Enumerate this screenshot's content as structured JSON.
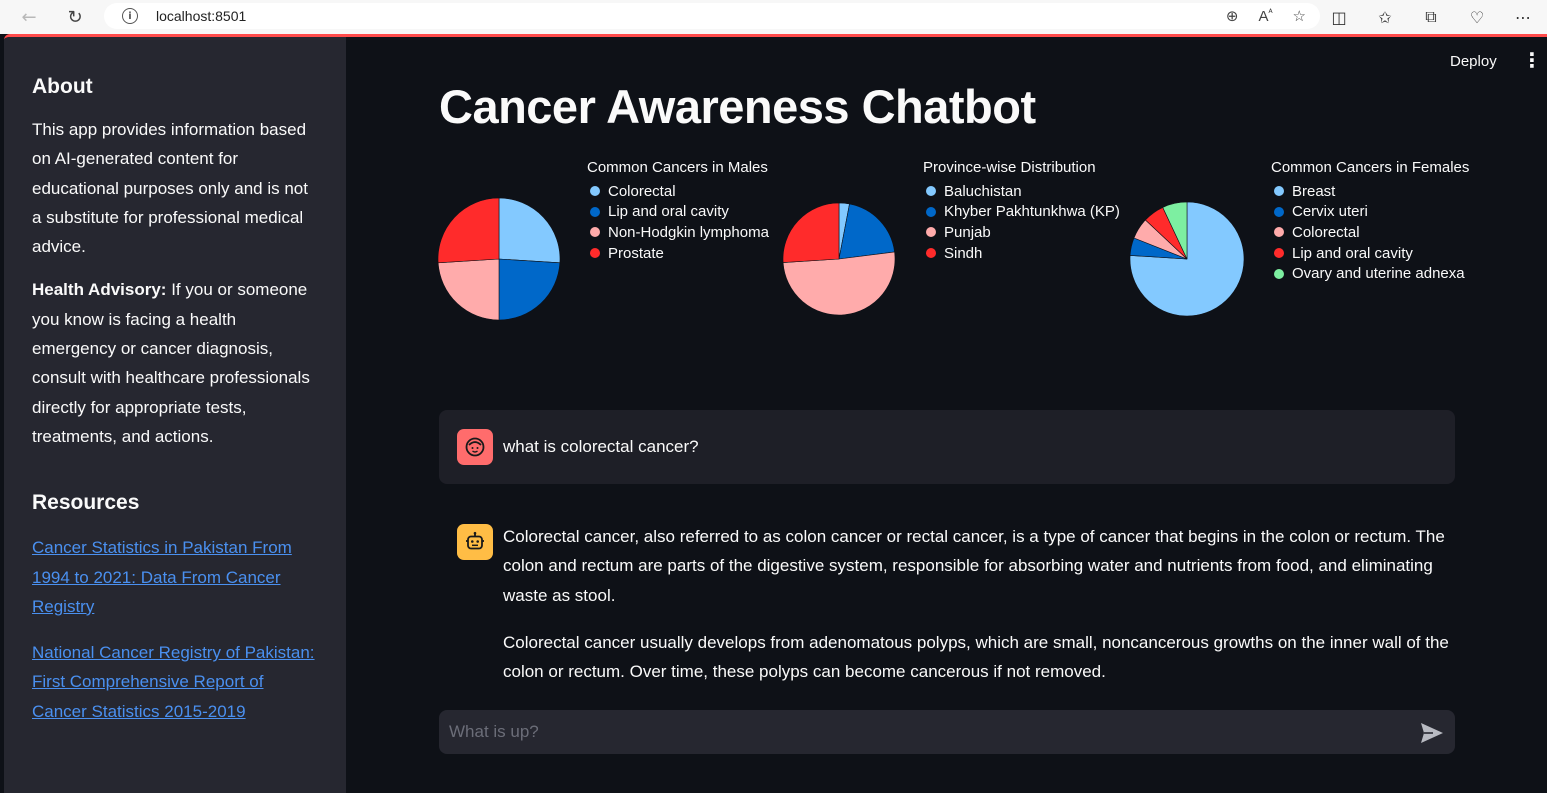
{
  "browser": {
    "url": "localhost:8501"
  },
  "header": {
    "deploy_label": "Deploy",
    "menu_glyph": "⋮"
  },
  "sidebar": {
    "about_heading": "About",
    "about_text": "This app provides information based on AI-generated content for educational purposes only and is not a substitute for professional medical advice.",
    "advisory_label": "Health Advisory:",
    "advisory_text": " If you or someone you know is facing a health emergency or cancer diagnosis, consult with healthcare professionals directly for appropriate tests, treatments, and actions.",
    "resources_heading": "Resources",
    "links": [
      "Cancer Statistics in Pakistan From 1994 to 2021: Data From Cancer Registry",
      "National Cancer Registry of Pakistan: First Comprehensive Report of Cancer Statistics 2015-2019"
    ]
  },
  "main": {
    "title": "Cancer Awareness Chatbot"
  },
  "chart_data": [
    {
      "type": "pie",
      "legend_title": "Common Cancers in Males",
      "categories": [
        "Colorectal",
        "Lip and oral cavity",
        "Non-Hodgkin lymphoma",
        "Prostate"
      ],
      "values": [
        26,
        24,
        24,
        26
      ],
      "colors": [
        "#83c9ff",
        "#0068c9",
        "#ffabab",
        "#ff2b2b"
      ],
      "legend_position": "right"
    },
    {
      "type": "pie",
      "legend_title": "Province-wise Distribution",
      "categories": [
        "Baluchistan",
        "Khyber Pakhtunkhwa (KP)",
        "Punjab",
        "Sindh"
      ],
      "values": [
        3,
        20,
        51,
        26
      ],
      "colors": [
        "#83c9ff",
        "#0068c9",
        "#ffabab",
        "#ff2b2b"
      ],
      "legend_position": "right"
    },
    {
      "type": "pie",
      "legend_title": "Common Cancers in Females",
      "categories": [
        "Breast",
        "Cervix uteri",
        "Colorectal",
        "Lip and oral cavity",
        "Ovary and uterine adnexa"
      ],
      "values": [
        76,
        5,
        6,
        6,
        7
      ],
      "colors": [
        "#83c9ff",
        "#0068c9",
        "#ffabab",
        "#ff2b2b",
        "#7defa1"
      ],
      "legend_position": "right"
    }
  ],
  "chat": {
    "user_message": "what is colorectal cancer?",
    "bot_paragraphs": [
      "Colorectal cancer, also referred to as colon cancer or rectal cancer, is a type of cancer that begins in the colon or rectum. The colon and rectum are parts of the digestive system, responsible for absorbing water and nutrients from food, and eliminating waste as stool.",
      "Colorectal cancer usually develops from adenomatous polyps, which are small, noncancerous growths on the inner wall of the colon or rectum. Over time, these polyps can become cancerous if not removed."
    ],
    "input_placeholder": "What is up?"
  }
}
